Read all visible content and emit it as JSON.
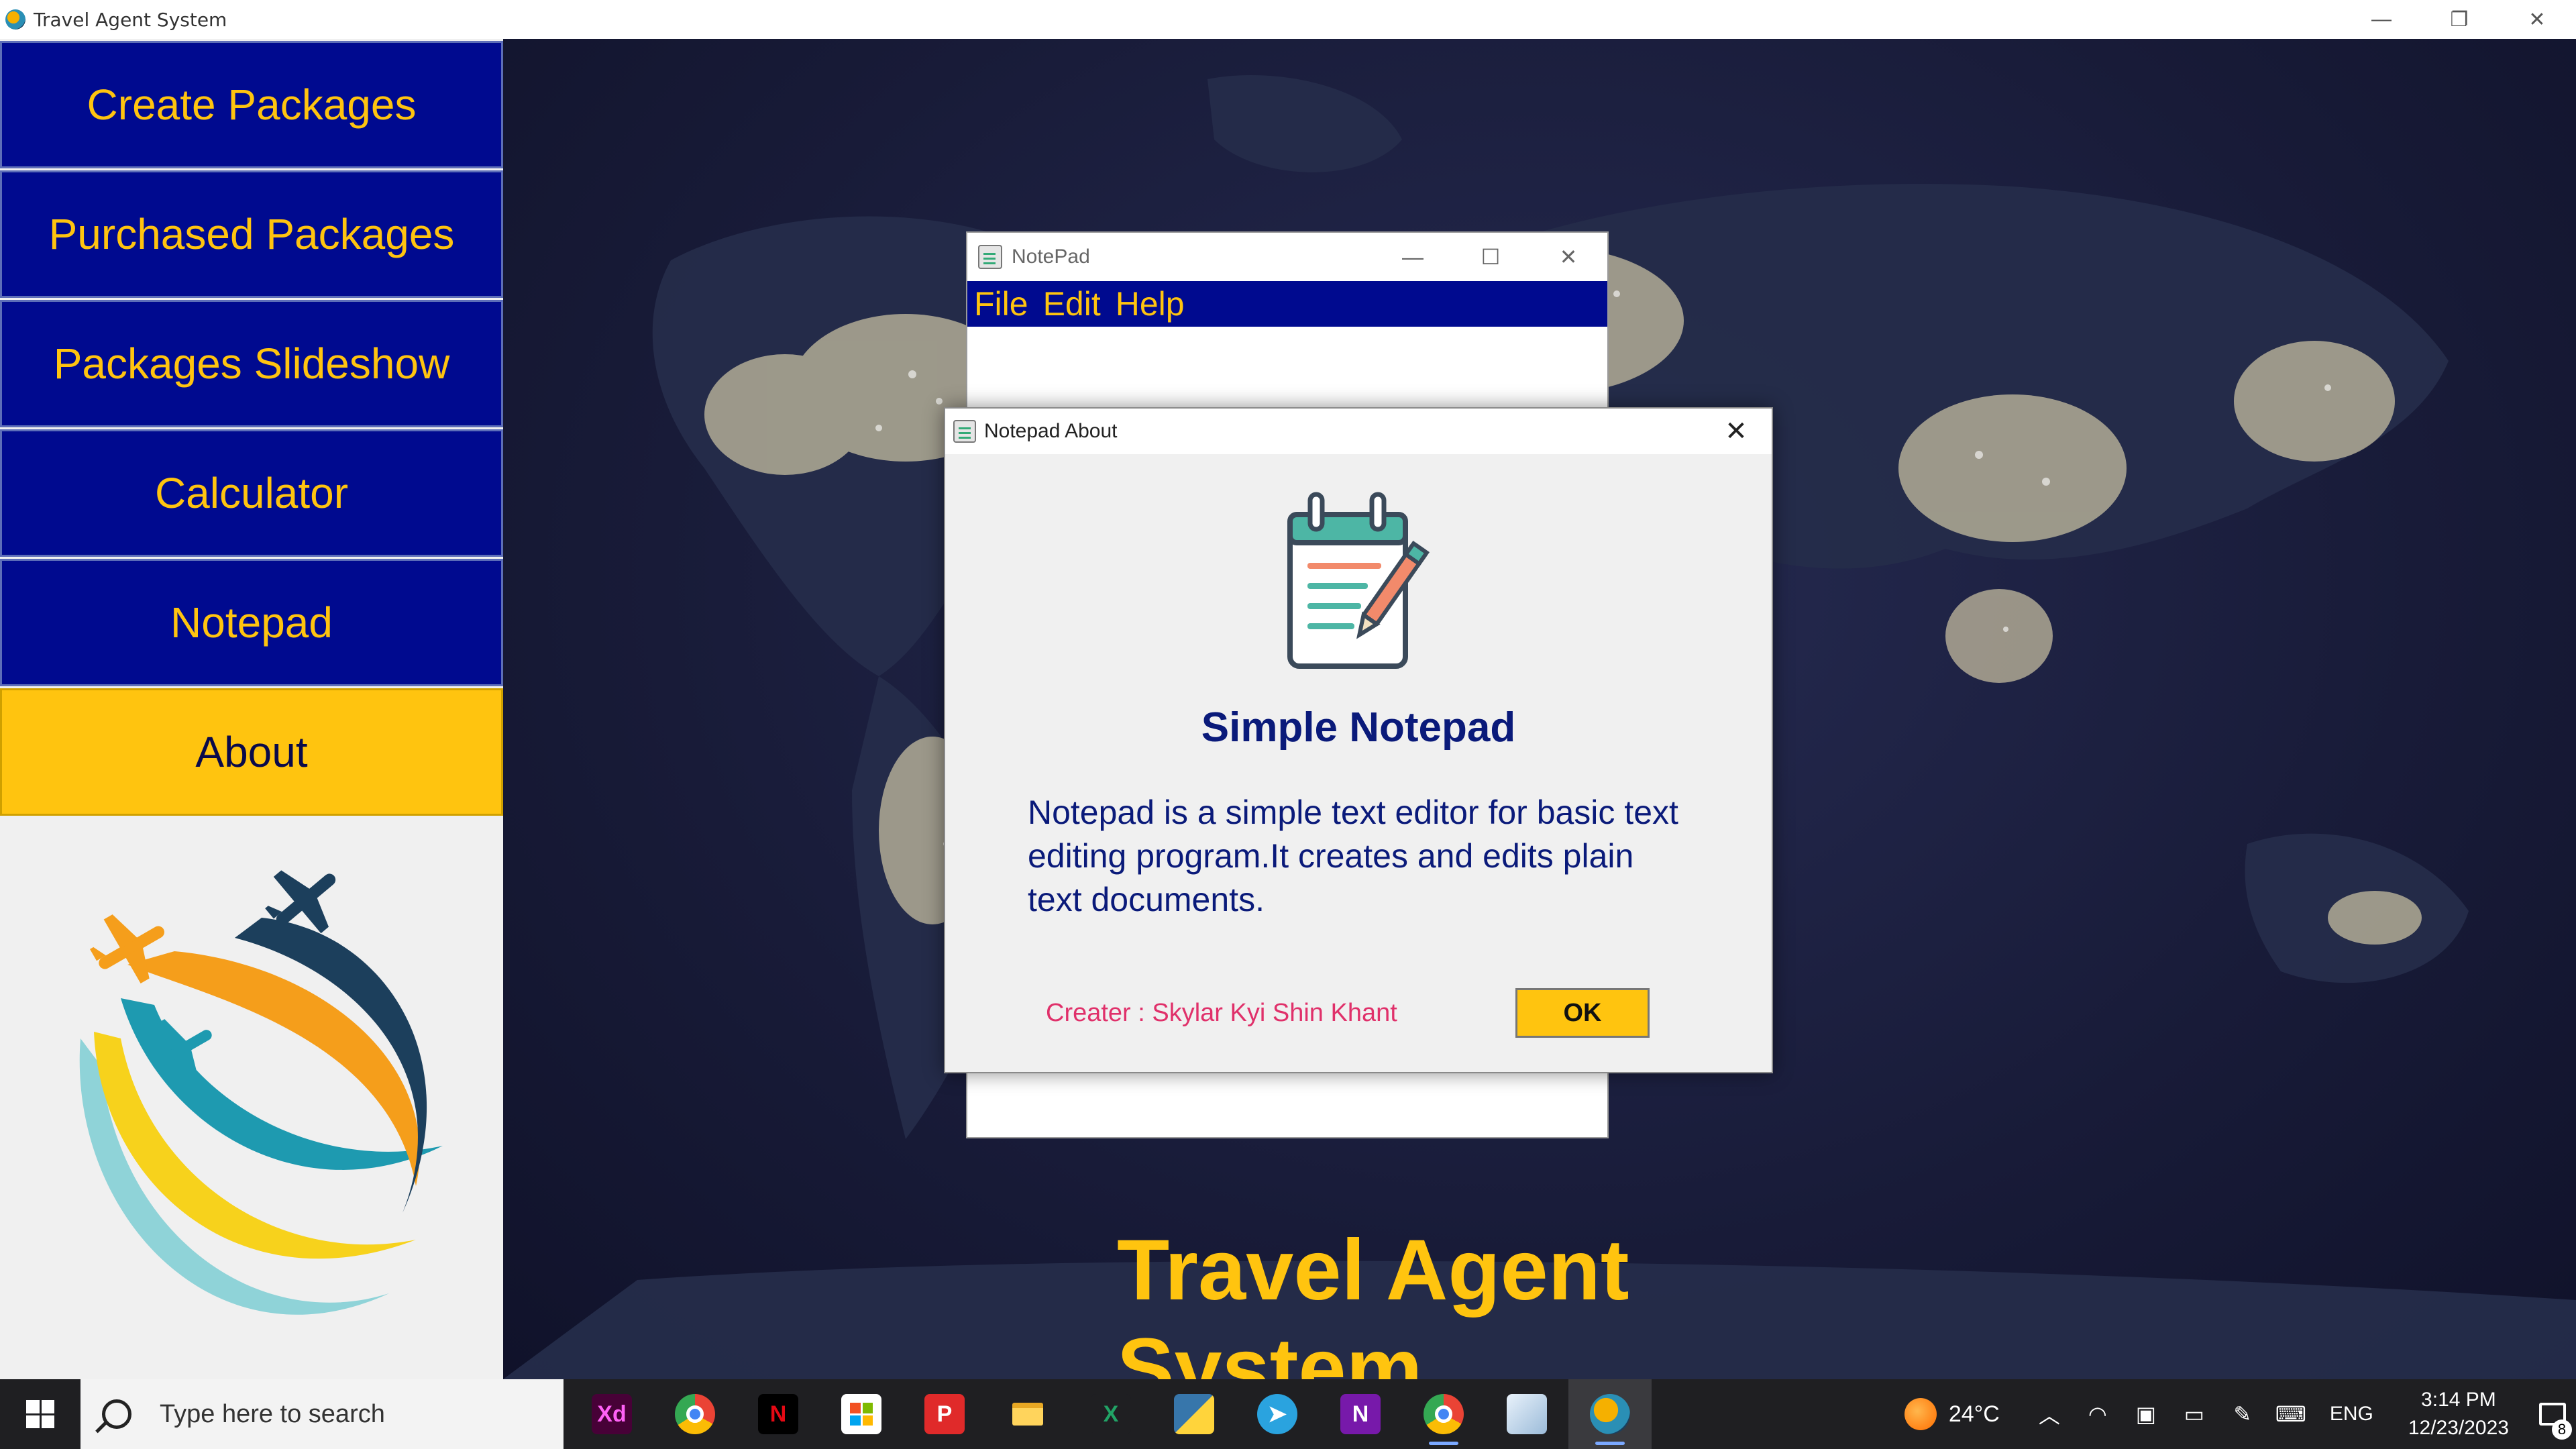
{
  "window": {
    "title": "Travel Agent System",
    "controls": {
      "minimize": "—",
      "restore": "❐",
      "close": "✕"
    }
  },
  "sidebar": {
    "items": [
      {
        "label": "Create Packages",
        "active": false
      },
      {
        "label": "Purchased Packages",
        "active": false
      },
      {
        "label": "Packages Slideshow",
        "active": false
      },
      {
        "label": "Calculator",
        "active": false
      },
      {
        "label": "Notepad",
        "active": false
      },
      {
        "label": "About",
        "active": true
      }
    ]
  },
  "main": {
    "title": "Travel Agent System"
  },
  "notepad": {
    "title": "NotePad",
    "menu": [
      "File",
      "Edit",
      "Help"
    ],
    "controls": {
      "minimize": "—",
      "maximize": "☐",
      "close": "✕"
    }
  },
  "about_dialog": {
    "title": "Notepad About",
    "close": "✕",
    "heading": "Simple Notepad",
    "description_lines": [
      "Notepad is a simple text editor for basic text",
      "editing program.It creates and edits plain",
      "text documents."
    ],
    "creator": "Creater : Skylar Kyi Shin Khant",
    "ok_label": "OK"
  },
  "taskbar": {
    "search_placeholder": "Type here to search",
    "apps": [
      {
        "name": "adobe-xd-icon",
        "text": "Xd",
        "color": "#470137",
        "fg": "#ff61f6",
        "running": false
      },
      {
        "name": "chrome-icon",
        "text": "",
        "color": "#ffffff",
        "fg": "#ffffff",
        "running": false
      },
      {
        "name": "netflix-icon",
        "text": "N",
        "color": "#000000",
        "fg": "#e50914",
        "running": false
      },
      {
        "name": "microsoft-store-icon",
        "text": "",
        "color": "#ffffff",
        "fg": "#ffffff",
        "running": false
      },
      {
        "name": "psiphon-icon",
        "text": "P",
        "color": "#e02a2a",
        "fg": "#ffffff",
        "running": false
      },
      {
        "name": "file-explorer-icon",
        "text": "",
        "color": "#f7c744",
        "fg": "#ffffff",
        "running": false
      },
      {
        "name": "excel-icon",
        "text": "X",
        "color": "#1f1f22",
        "fg": "#21a366",
        "running": false
      },
      {
        "name": "python-icon",
        "text": "",
        "color": "#3776ab",
        "fg": "#ffd43b",
        "running": false
      },
      {
        "name": "telegram-icon",
        "text": "➤",
        "color": "#2aa3df",
        "fg": "#ffffff",
        "running": false
      },
      {
        "name": "onenote-icon",
        "text": "N",
        "color": "#7719aa",
        "fg": "#ffffff",
        "running": false
      },
      {
        "name": "chrome-profile-icon",
        "text": "",
        "color": "#ffffff",
        "fg": "#ffffff",
        "running": true
      },
      {
        "name": "virtualbox-icon",
        "text": "",
        "color": "#c9dcef",
        "fg": "#ffffff",
        "running": false
      },
      {
        "name": "travel-agent-app-icon",
        "text": "",
        "color": "#2a8fb5",
        "fg": "#ffffff",
        "running": true,
        "active": true
      }
    ],
    "tray": {
      "temperature": "24°C",
      "language": "ENG",
      "time": "3:14 PM",
      "date": "12/23/2023",
      "notification_count": "8"
    }
  },
  "colors": {
    "nav_bg": "#000a8f",
    "accent_yellow": "#ffc40f",
    "dialog_text": "#0a1a7a",
    "creator_text": "#e0306a"
  }
}
